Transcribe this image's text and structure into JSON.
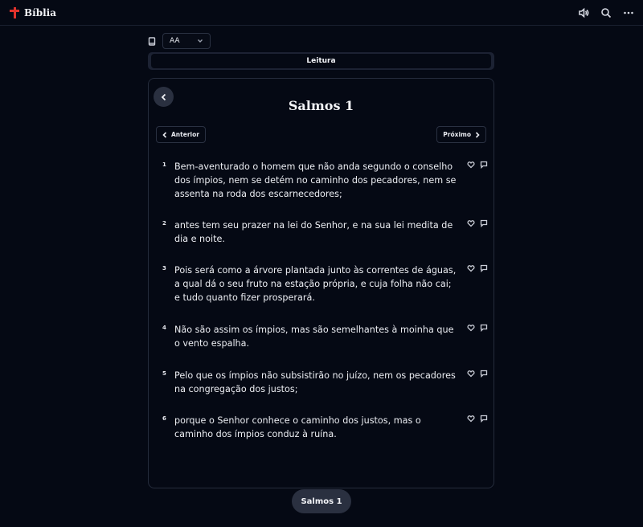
{
  "app": {
    "name": "Bíblia"
  },
  "header": {
    "icons": [
      "speaker-icon",
      "search-icon",
      "more-icon"
    ]
  },
  "controls": {
    "book_icon": "book-icon",
    "font_size": {
      "value": "AA",
      "options": [
        "AA"
      ]
    }
  },
  "tabs": [
    {
      "label": "Leitura",
      "active": true
    }
  ],
  "reader": {
    "chapter_title": "Salmos 1",
    "prev_label": "Anterior",
    "next_label": "Próximo",
    "verses": [
      {
        "num": "1",
        "text": "Bem-aventurado o homem que não anda segundo o conselho dos ímpios, nem se detém no caminho dos pecadores, nem se assenta na roda dos escarnecedores;"
      },
      {
        "num": "2",
        "text": "antes tem seu prazer na lei do Senhor, e na sua lei medita de dia e noite."
      },
      {
        "num": "3",
        "text": "Pois será como a árvore plantada junto às correntes de águas, a qual dá o seu fruto na estação própria, e cuja folha não cai; e tudo quanto fizer prosperará."
      },
      {
        "num": "4",
        "text": "Não são assim os ímpios, mas são semelhantes à moinha que o vento espalha."
      },
      {
        "num": "5",
        "text": "Pelo que os ímpios não subsistirão no juízo, nem os pecadores na congregação dos justos;"
      },
      {
        "num": "6",
        "text": "porque o Senhor conhece o caminho dos justos, mas o caminho dos ímpios conduz à ruína."
      }
    ]
  },
  "footer": {
    "chapter_pill": "Salmos 1"
  },
  "colors": {
    "background": "#050914",
    "accent": "#e0322c",
    "surface": "#2a3040"
  }
}
